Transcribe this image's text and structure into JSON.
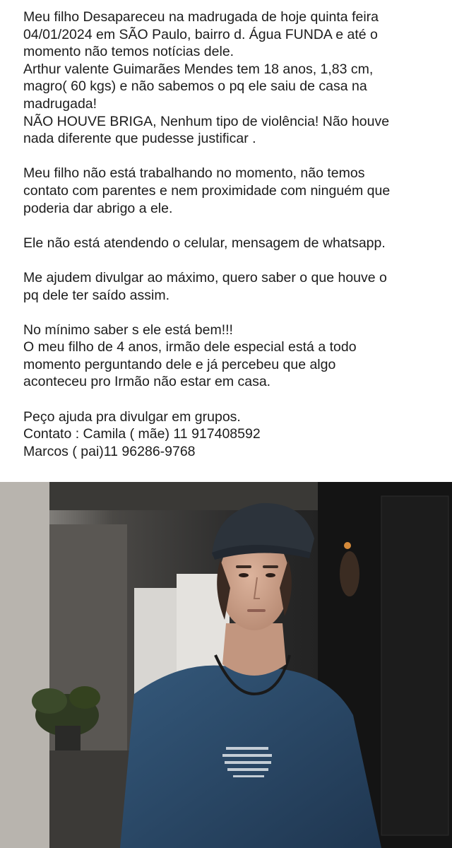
{
  "post": {
    "paragraphs": [
      {
        "lines": [
          "Meu filho Desapareceu na madrugada de hoje quinta feira",
          "04/01/2024 em SÃO Paulo, bairro d. Água FUNDA e até o",
          "momento não temos notícias dele.",
          "Arthur valente Guimarães Mendes tem 18 anos, 1,83 cm,",
          "magro( 60 kgs) e não sabemos o pq ele saiu de casa na",
          "madrugada!",
          "NÃO HOUVE BRIGA,  Nenhum tipo de violência! Não houve",
          "nada diferente que pudesse justificar ."
        ]
      },
      {
        "lines": [
          "Meu filho não está trabalhando no momento, não temos",
          "contato com parentes e nem proximidade com ninguém que",
          "poderia dar abrigo a ele."
        ]
      },
      {
        "lines": [
          "Ele não está atendendo o celular, mensagem de whatsapp."
        ]
      },
      {
        "lines": [
          "Me ajudem divulgar ao máximo, quero saber o que houve o",
          "pq dele ter saído assim."
        ]
      },
      {
        "lines": [
          "No mínimo saber s ele está bem!!!",
          "O meu filho de 4 anos, irmão dele especial está a todo",
          "momento perguntando dele e já percebeu que algo",
          "aconteceu pro  Irmão não estar em casa."
        ]
      },
      {
        "lines": [
          "Peço ajuda pra divulgar em grupos.",
          "Contato : Camila ( mãe) 11 917408592",
          "Marcos ( pai)11 96286-9768"
        ]
      }
    ]
  },
  "photo": {
    "colors": {
      "shirt": "#2b4966",
      "cap": "#2c333b",
      "skin": "#cfa58f",
      "hair": "#3a2a22",
      "background": "#1d1e1f"
    }
  }
}
